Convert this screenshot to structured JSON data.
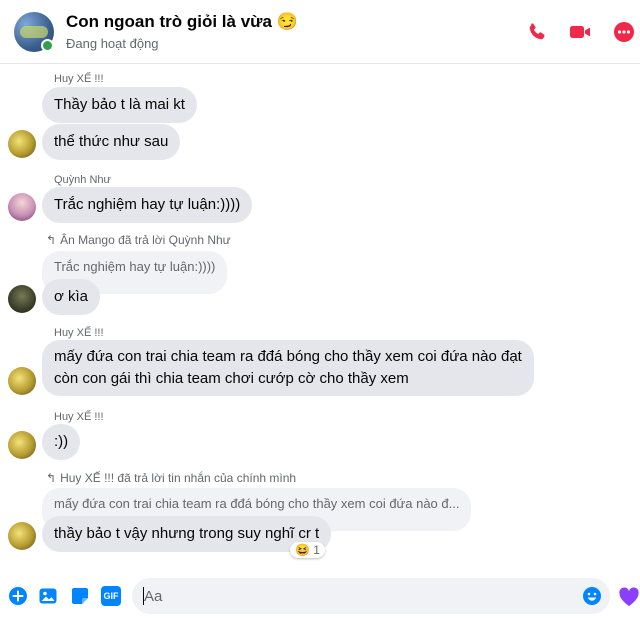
{
  "header": {
    "title": "Con ngoan trò giỏi là vừa 😏",
    "status": "Đang hoạt động"
  },
  "icons": {
    "call": "phone-icon",
    "video": "video-camera-icon",
    "more": "more-options-icon",
    "accent": "#f02849"
  },
  "messages": {
    "m1": {
      "sender": "Huy XẾ !!!",
      "text": "Thầy bảo t là mai kt"
    },
    "m2": {
      "text": "thể thức như sau"
    },
    "m3": {
      "sender": "Quỳnh Như",
      "text": "Trắc nghiệm hay tự luận:))))"
    },
    "m4": {
      "reply_info": "Ân Mango đã trả lời Quỳnh Như",
      "quoted": "Trắc nghiệm hay tự luận:))))",
      "text": "ơ kìa"
    },
    "m5": {
      "sender": "Huy XẾ !!!",
      "line1": "mấy đứa con trai chia team ra đđá bóng cho thầy xem coi đứa nào đạt",
      "line2": "còn con gái thì chia team chơi cướp cờ cho thầy xem"
    },
    "m6": {
      "sender": "Huy XẾ !!!",
      "text": ":))"
    },
    "m7": {
      "reply_info": "Huy XẾ !!! đã trả lời tin nhắn của chính mình",
      "quoted": "mấy đứa con trai chia team ra đđá bóng cho thầy xem coi đứa nào đ...",
      "text": "thầy bảo t vậy nhưng trong suy nghĩ cr t",
      "reaction_emoji": "😆",
      "reaction_count": "1"
    }
  },
  "composer": {
    "placeholder": "Aa",
    "gif_label": "GIF",
    "accent": "#0084ff"
  }
}
